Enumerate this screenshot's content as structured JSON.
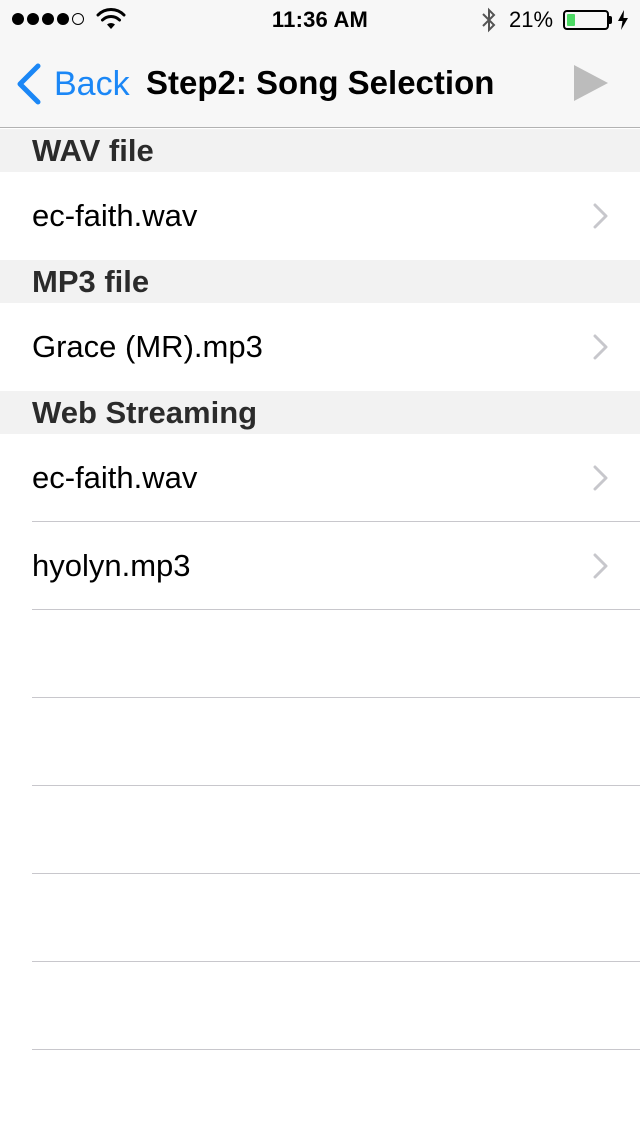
{
  "status_bar": {
    "time": "11:36 AM",
    "battery_percent": "21%",
    "battery_level": 0.21,
    "signal_bars": 4,
    "signal_max": 5,
    "battery_fill_color": "#4cd964"
  },
  "nav": {
    "back_label": "Back",
    "title": "Step2: Song Selection",
    "accent_color": "#1b87f6"
  },
  "sections": [
    {
      "header": "WAV file",
      "items": [
        "ec-faith.wav"
      ]
    },
    {
      "header": "MP3 file",
      "items": [
        "Grace (MR).mp3"
      ]
    },
    {
      "header": "Web Streaming",
      "items": [
        "ec-faith.wav",
        "hyolyn.mp3"
      ]
    }
  ]
}
